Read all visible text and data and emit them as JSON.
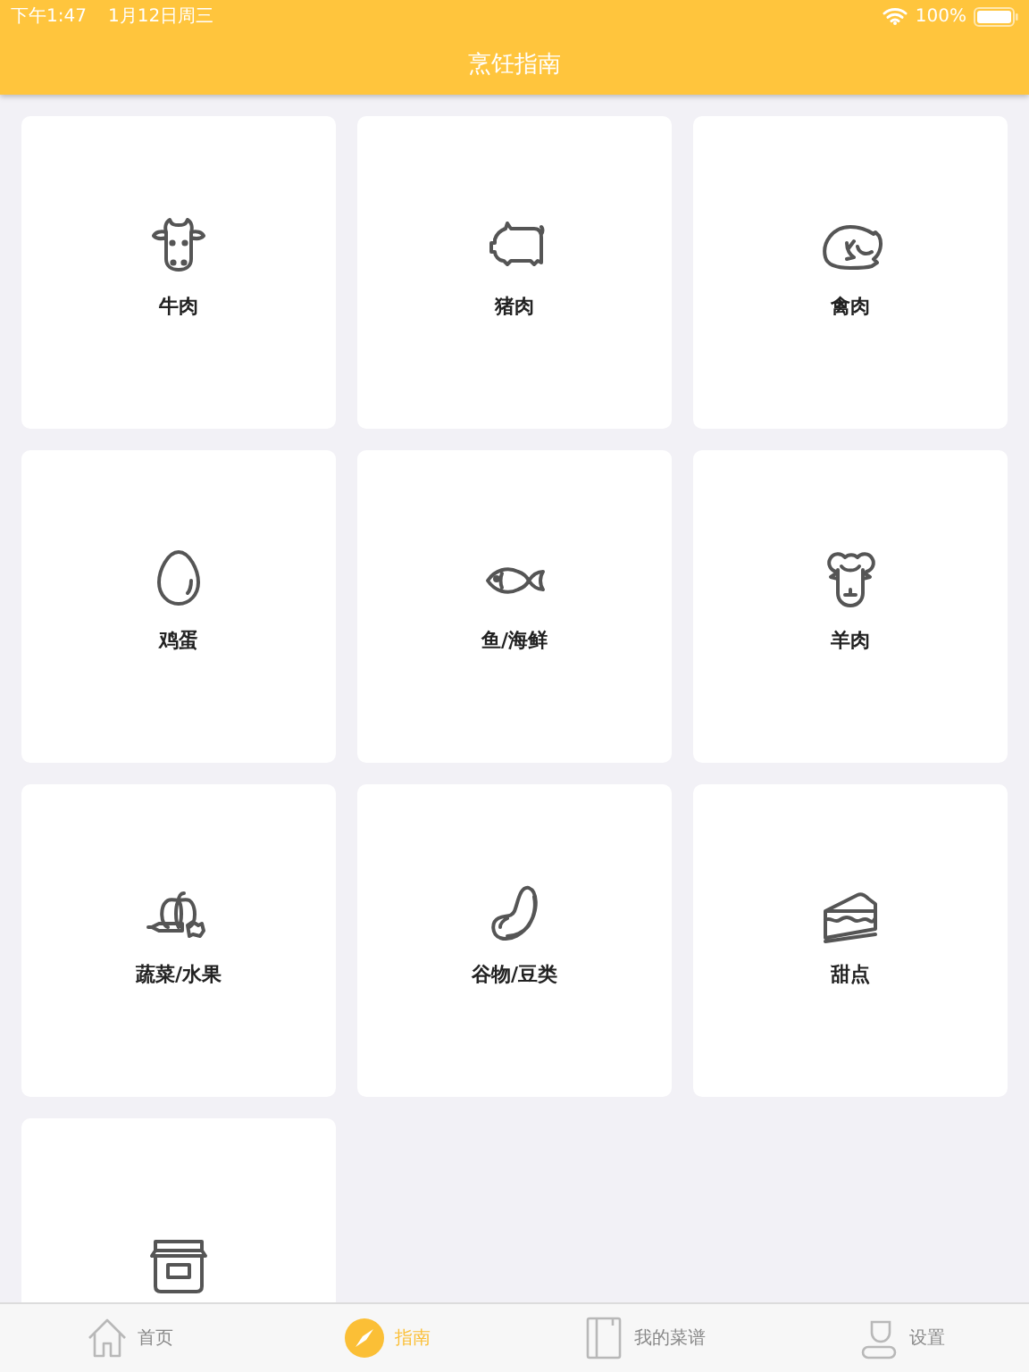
{
  "status_bar": {
    "time": "下午1:47",
    "date": "1月12日周三",
    "battery": "100%"
  },
  "nav_bar": {
    "title": "烹饪指南"
  },
  "categories": [
    {
      "kind": "cow",
      "label": "牛肉"
    },
    {
      "kind": "pig",
      "label": "猪肉"
    },
    {
      "kind": "poultry",
      "label": "禽肉"
    },
    {
      "kind": "egg",
      "label": "鸡蛋"
    },
    {
      "kind": "fish",
      "label": "鱼/海鲜"
    },
    {
      "kind": "sheep",
      "label": "羊肉"
    },
    {
      "kind": "vegetable",
      "label": "蔬菜/水果"
    },
    {
      "kind": "bean",
      "label": "谷物/豆类"
    },
    {
      "kind": "cake",
      "label": "甜点"
    },
    {
      "kind": "jar"
    }
  ],
  "tab_bar": [
    {
      "kind": "home",
      "label": "首页",
      "selected": false
    },
    {
      "kind": "compass",
      "label": "指南",
      "selected": true
    },
    {
      "kind": "book",
      "label": "我的菜谱",
      "selected": false
    },
    {
      "kind": "person",
      "label": "设置",
      "selected": false
    }
  ]
}
